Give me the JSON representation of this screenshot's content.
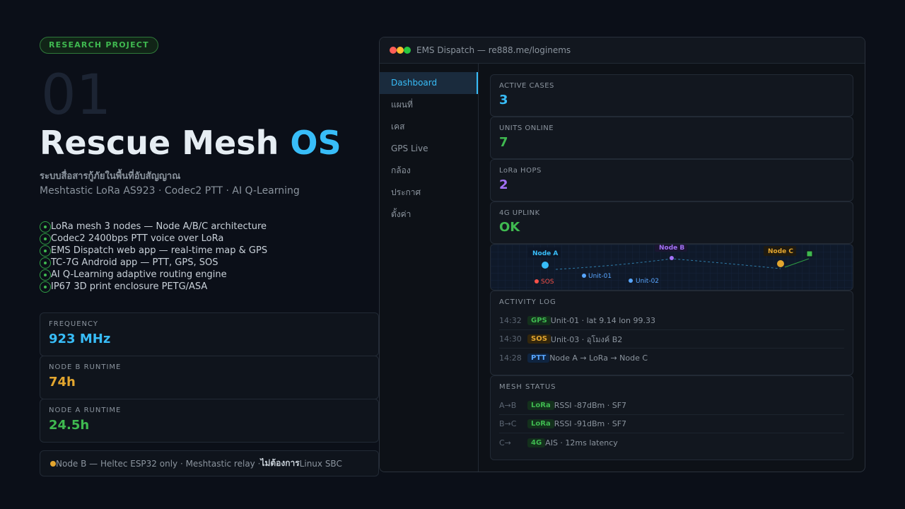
{
  "hero": {
    "badge": "RESEARCH PROJECT",
    "number": "01",
    "title_main": "Rescue Mesh ",
    "title_accent": "OS",
    "subtitle_th": "ระบบสื่อสารกู้ภัยในพื้นที่อับสัญญาณ",
    "subtitle_en": "Meshtastic LoRa AS923 · Codec2 PTT · AI Q-Learning"
  },
  "features": [
    "LoRa mesh 3 nodes — Node A/B/C architecture",
    "Codec2 2400bps PTT voice over LoRa",
    "EMS Dispatch web app — real-time map & GPS",
    "TC-7G Android app — PTT, GPS, SOS",
    "AI Q-Learning adaptive routing engine",
    "IP67 3D print enclosure PETG/ASA"
  ],
  "stats": [
    {
      "label": "FREQUENCY",
      "value": "923 MHz",
      "color": "#38bdf8"
    },
    {
      "label": "NODE B RUNTIME",
      "value": "74h",
      "color": "#e3a62f"
    },
    {
      "label": "NODE A RUNTIME",
      "value": "24.5h",
      "color": "#3fb950"
    }
  ],
  "note": {
    "pre": "Node B — Heltec ESP32 only · Meshtastic relay · ",
    "bold": "ไม่ต้องการ",
    "post": " Linux SBC"
  },
  "window": {
    "title": "EMS Dispatch — re888.me/loginems",
    "lights": [
      "#ff5f57",
      "#febc2e",
      "#28c840"
    ]
  },
  "sidebar": {
    "items": [
      "Dashboard",
      "แผนที่",
      "เคส",
      "GPS Live",
      "กล้อง",
      "ประกาศ",
      "ตั้งค่า"
    ],
    "active": 0
  },
  "kpis": [
    {
      "label": "ACTIVE CASES",
      "value": "3",
      "color": "#38bdf8"
    },
    {
      "label": "UNITS ONLINE",
      "value": "7",
      "color": "#3fb950"
    },
    {
      "label": "LoRa HOPS",
      "value": "2",
      "color": "#a371f7"
    },
    {
      "label": "4G UPLINK",
      "value": "OK",
      "color": "#3fb950"
    }
  ],
  "map": {
    "node_a": "Node A",
    "node_b": "Node B",
    "node_c": "Node C",
    "sos": "SOS",
    "unit_01": "Unit-01",
    "unit_02": "Unit-02"
  },
  "activity": {
    "header": "ACTIVITY LOG",
    "rows": [
      {
        "time": "14:32",
        "tag": "GPS",
        "tag_color": "#3fb950",
        "tag_bg": "#13301c",
        "desc": "Unit-01 · lat 9.14 lon 99.33"
      },
      {
        "time": "14:30",
        "tag": "SOS",
        "tag_color": "#e3a62f",
        "tag_bg": "#33260c",
        "desc": "Unit-03 · อุโมงค์ B2"
      },
      {
        "time": "14:28",
        "tag": "PTT",
        "tag_color": "#58a6ff",
        "tag_bg": "#0f2440",
        "desc": "Node A → LoRa → Node C"
      }
    ]
  },
  "mesh": {
    "header": "MESH STATUS",
    "rows": [
      {
        "time": "A→B",
        "tag": "LoRa",
        "tag_color": "#3fb950",
        "tag_bg": "#13301c",
        "desc": "RSSI -87dBm · SF7"
      },
      {
        "time": "B→C",
        "tag": "LoRa",
        "tag_color": "#3fb950",
        "tag_bg": "#13301c",
        "desc": "RSSI -91dBm · SF7"
      },
      {
        "time": "C→",
        "tag": "4G",
        "tag_color": "#3fb950",
        "tag_bg": "#13301c",
        "desc": "AIS · 12ms latency"
      }
    ]
  }
}
